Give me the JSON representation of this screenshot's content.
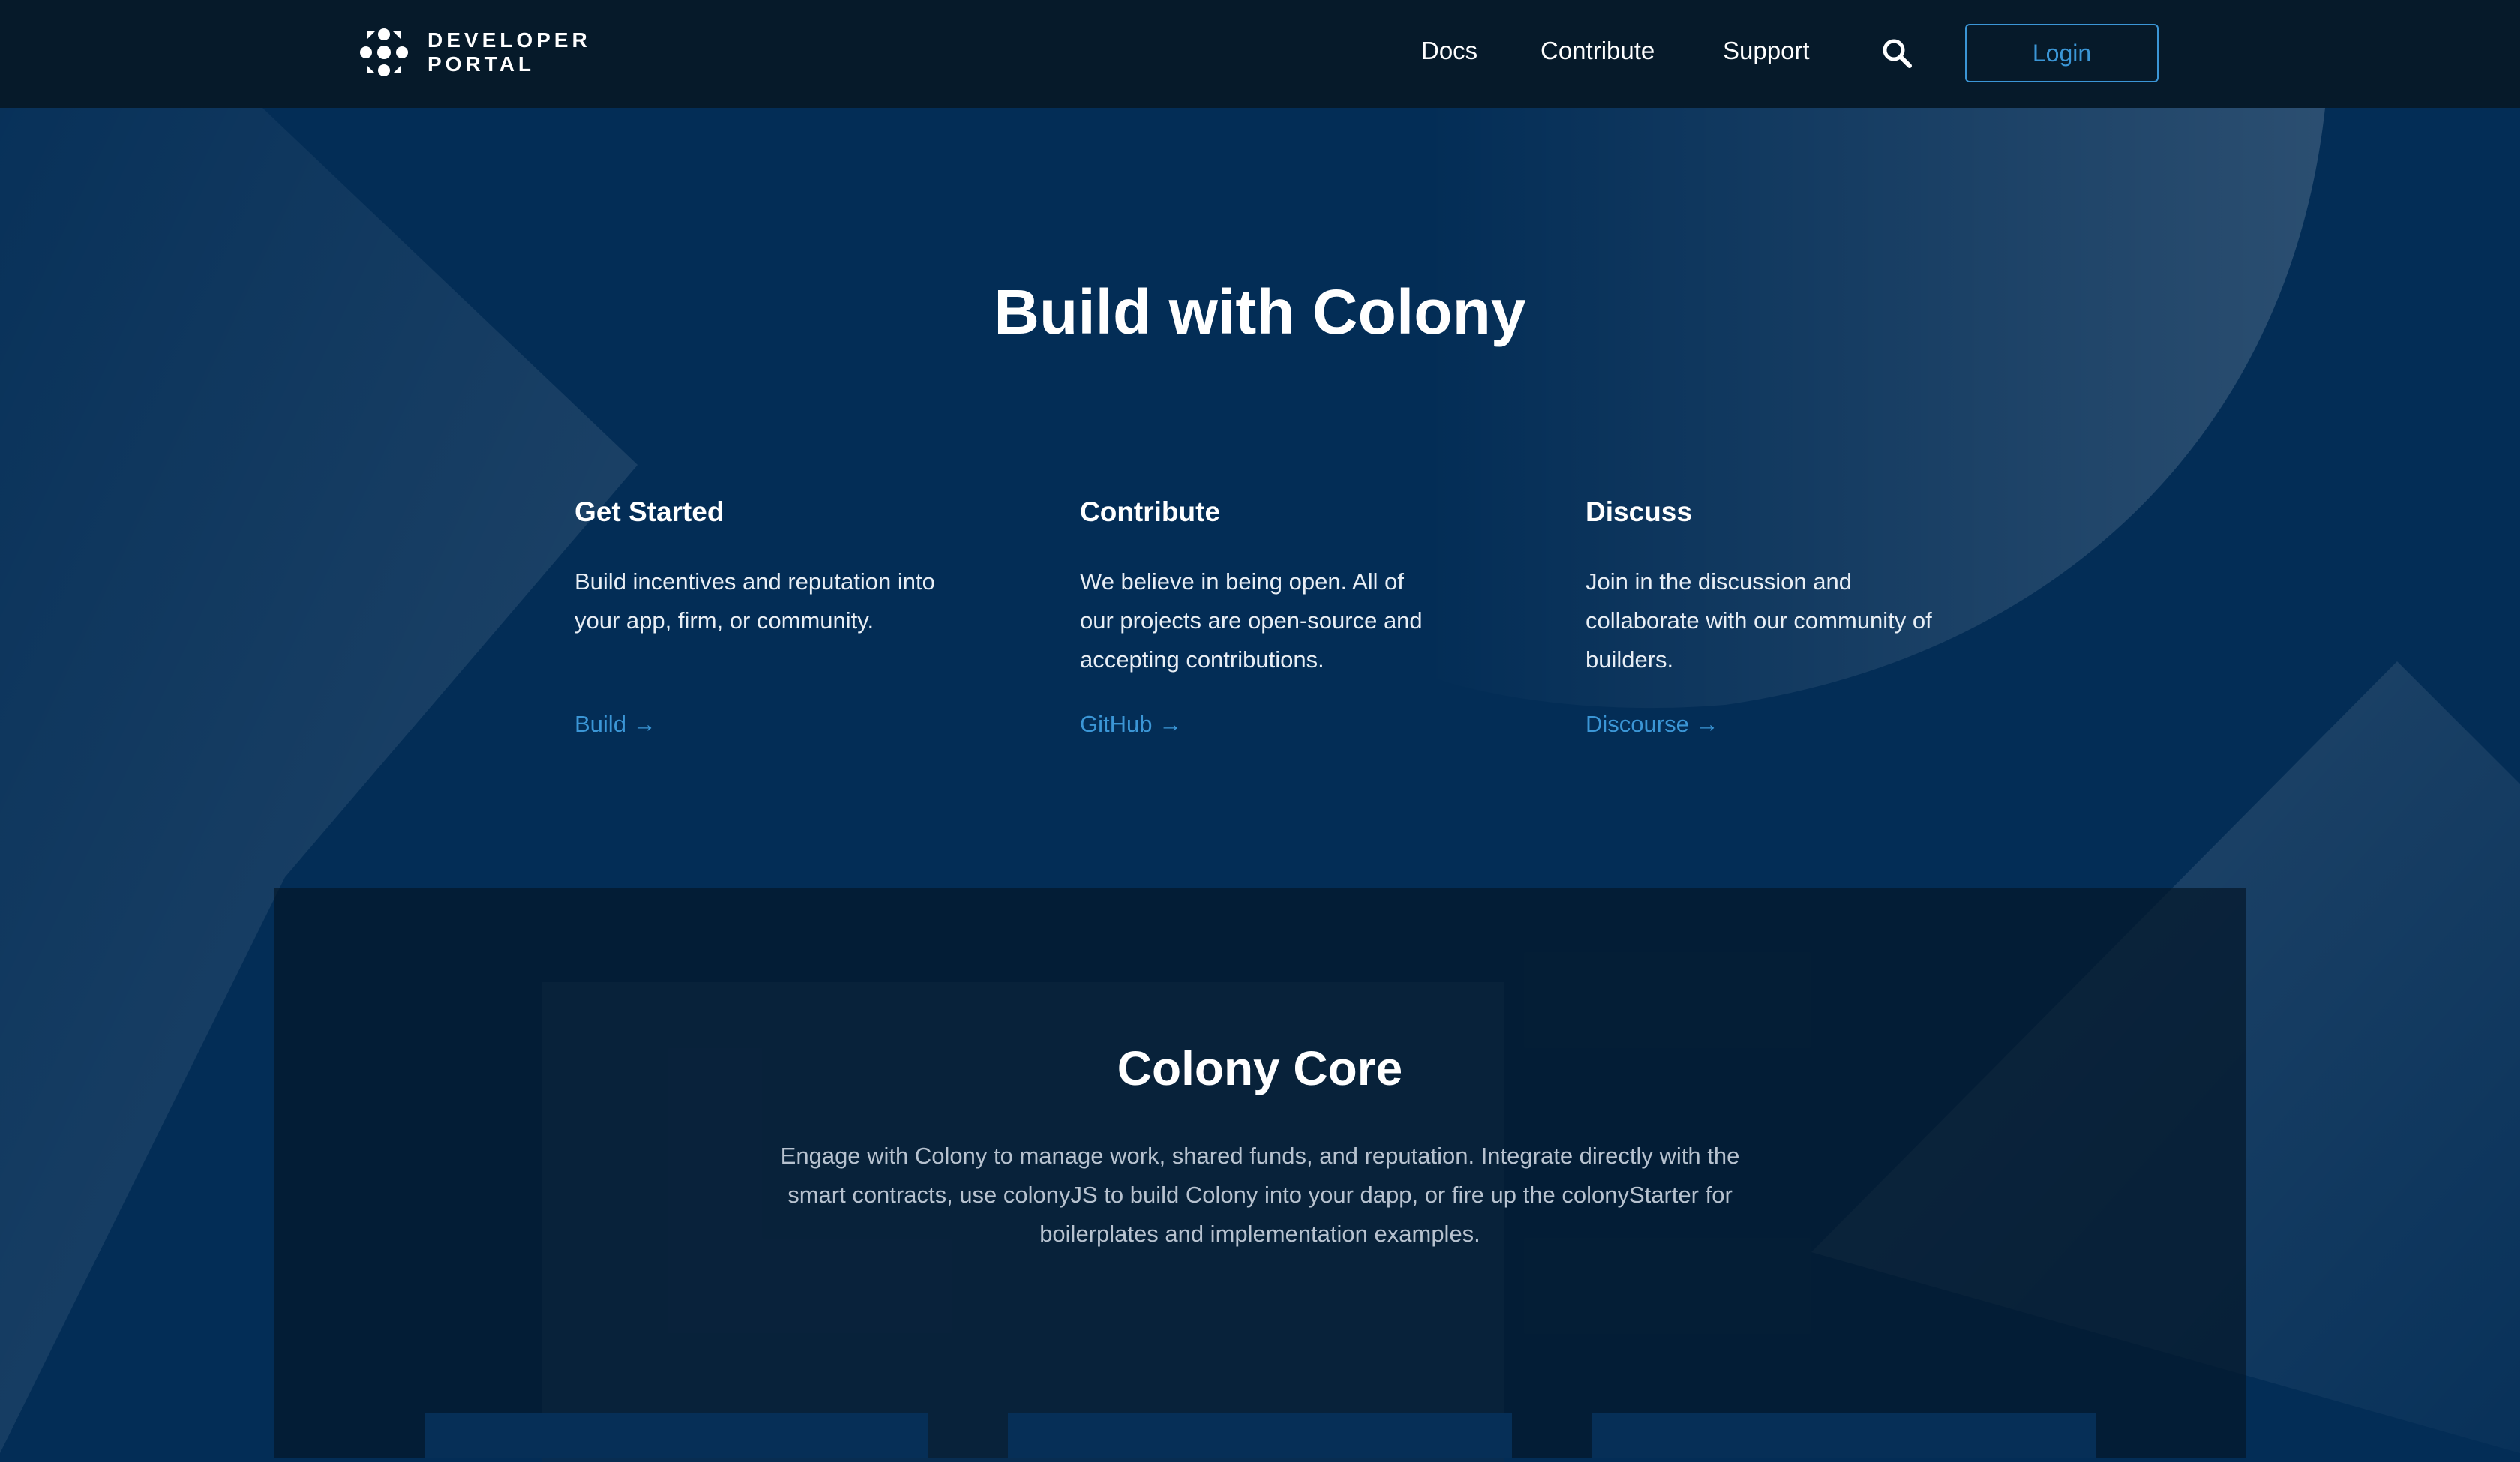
{
  "header": {
    "logo_line1": "DEVELOPER",
    "logo_line2": "PORTAL",
    "nav": [
      {
        "label": "Docs"
      },
      {
        "label": "Contribute"
      },
      {
        "label": "Support"
      }
    ],
    "search_icon": "search-icon",
    "login_label": "Login"
  },
  "hero": {
    "title": "Build with Colony",
    "cards": [
      {
        "title": "Get Started",
        "description": "Build incentives and reputation into your app, firm, or community.",
        "link": "Build →"
      },
      {
        "title": "Contribute",
        "description": "We believe in being open. All of our projects are open-source and accepting contributions.",
        "link": "GitHub →"
      },
      {
        "title": "Discuss",
        "description": "Join in the discussion and collaborate with our community of builders.",
        "link": "Discourse →"
      }
    ]
  },
  "core": {
    "title": "Colony Core",
    "description": "Engage with Colony to manage work, shared funds, and reputation. Integrate directly with the smart contracts, use colonyJS to build Colony into your dapp, or fire up the colonyStarter for boilerplates and implementation examples."
  },
  "colors": {
    "header_bg": "#061a2a",
    "page_bg": "#032d56",
    "accent": "#3b96d6"
  }
}
